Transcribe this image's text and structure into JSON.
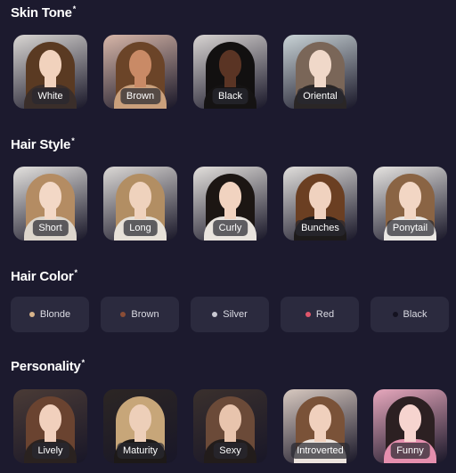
{
  "sections": {
    "skin_tone": {
      "title": "Skin Tone",
      "required_mark": "*",
      "options": [
        {
          "label": "White",
          "icon": "portrait-white-photo",
          "colors": {
            "bg": "#d9d6d3",
            "hair": "#5a3a22",
            "face": "#f1d2bd",
            "body": "#3a2e2a"
          }
        },
        {
          "label": "Brown",
          "icon": "portrait-brown-photo",
          "colors": {
            "bg": "#d7b6a8",
            "hair": "#6b4428",
            "face": "#c98a66",
            "body": "#caa07c"
          }
        },
        {
          "label": "Black",
          "icon": "portrait-black-photo",
          "colors": {
            "bg": "#d8d4d2",
            "hair": "#121010",
            "face": "#5a3424",
            "body": "#151313"
          }
        },
        {
          "label": "Oriental",
          "icon": "portrait-oriental-photo",
          "colors": {
            "bg": "#c9d3d6",
            "hair": "#7a6658",
            "face": "#f0d8c9",
            "body": "#2a2626"
          }
        }
      ]
    },
    "hair_style": {
      "title": "Hair Style",
      "required_mark": "*",
      "options": [
        {
          "label": "Short",
          "icon": "portrait-short-hair-photo",
          "colors": {
            "bg": "#e4e2df",
            "hair": "#b48c63",
            "face": "#f3d8c6",
            "body": "#ddd6cc"
          }
        },
        {
          "label": "Long",
          "icon": "portrait-long-hair-photo",
          "colors": {
            "bg": "#dcd9d6",
            "hair": "#b28e63",
            "face": "#efd2bd",
            "body": "#e7e1d8"
          }
        },
        {
          "label": "Curly",
          "icon": "portrait-curly-hair-photo",
          "colors": {
            "bg": "#e3e0dc",
            "hair": "#1c1613",
            "face": "#f1d3c0",
            "body": "#e9e4de"
          }
        },
        {
          "label": "Bunches",
          "icon": "portrait-bunches-hair-photo",
          "colors": {
            "bg": "#e1dfdc",
            "hair": "#6b3f22",
            "face": "#f0d2bf",
            "body": "#1d1a1a"
          }
        },
        {
          "label": "Ponytail",
          "icon": "portrait-ponytail-hair-photo",
          "colors": {
            "bg": "#e6e4e1",
            "hair": "#8a6444",
            "face": "#f2d6c4",
            "body": "#ebe8e4"
          }
        }
      ]
    },
    "hair_color": {
      "title": "Hair Color",
      "required_mark": "*",
      "options": [
        {
          "label": "Blonde",
          "dot_color": "#d7b38a"
        },
        {
          "label": "Brown",
          "dot_color": "#8a4d36"
        },
        {
          "label": "Silver",
          "dot_color": "#c9c9d2"
        },
        {
          "label": "Red",
          "dot_color": "#e0566b"
        },
        {
          "label": "Black",
          "dot_color": "#141220"
        }
      ]
    },
    "personality": {
      "title": "Personality",
      "required_mark": "*",
      "options": [
        {
          "label": "Lively",
          "icon": "portrait-lively-photo",
          "colors": {
            "bg": "#4a3b36",
            "hair": "#6a4330",
            "face": "#f1d0bd",
            "body": "#2a2220"
          }
        },
        {
          "label": "Maturity",
          "icon": "portrait-maturity-photo",
          "colors": {
            "bg": "#2c2624",
            "hair": "#c7a679",
            "face": "#edcfb9",
            "body": "#1d1918"
          }
        },
        {
          "label": "Sexy",
          "icon": "portrait-sexy-photo",
          "colors": {
            "bg": "#3a302d",
            "hair": "#6b4a38",
            "face": "#e8c4ad",
            "body": "#221c1b"
          }
        },
        {
          "label": "Introverted",
          "icon": "portrait-introverted-photo",
          "colors": {
            "bg": "#d8c9c0",
            "hair": "#7a5238",
            "face": "#f0d0bd",
            "body": "#ece4de"
          }
        },
        {
          "label": "Funny",
          "icon": "portrait-funny-photo",
          "colors": {
            "bg": "#e7a8bd",
            "hair": "#2c2022",
            "face": "#f6d4cf",
            "body": "#e58fae"
          }
        }
      ]
    }
  }
}
